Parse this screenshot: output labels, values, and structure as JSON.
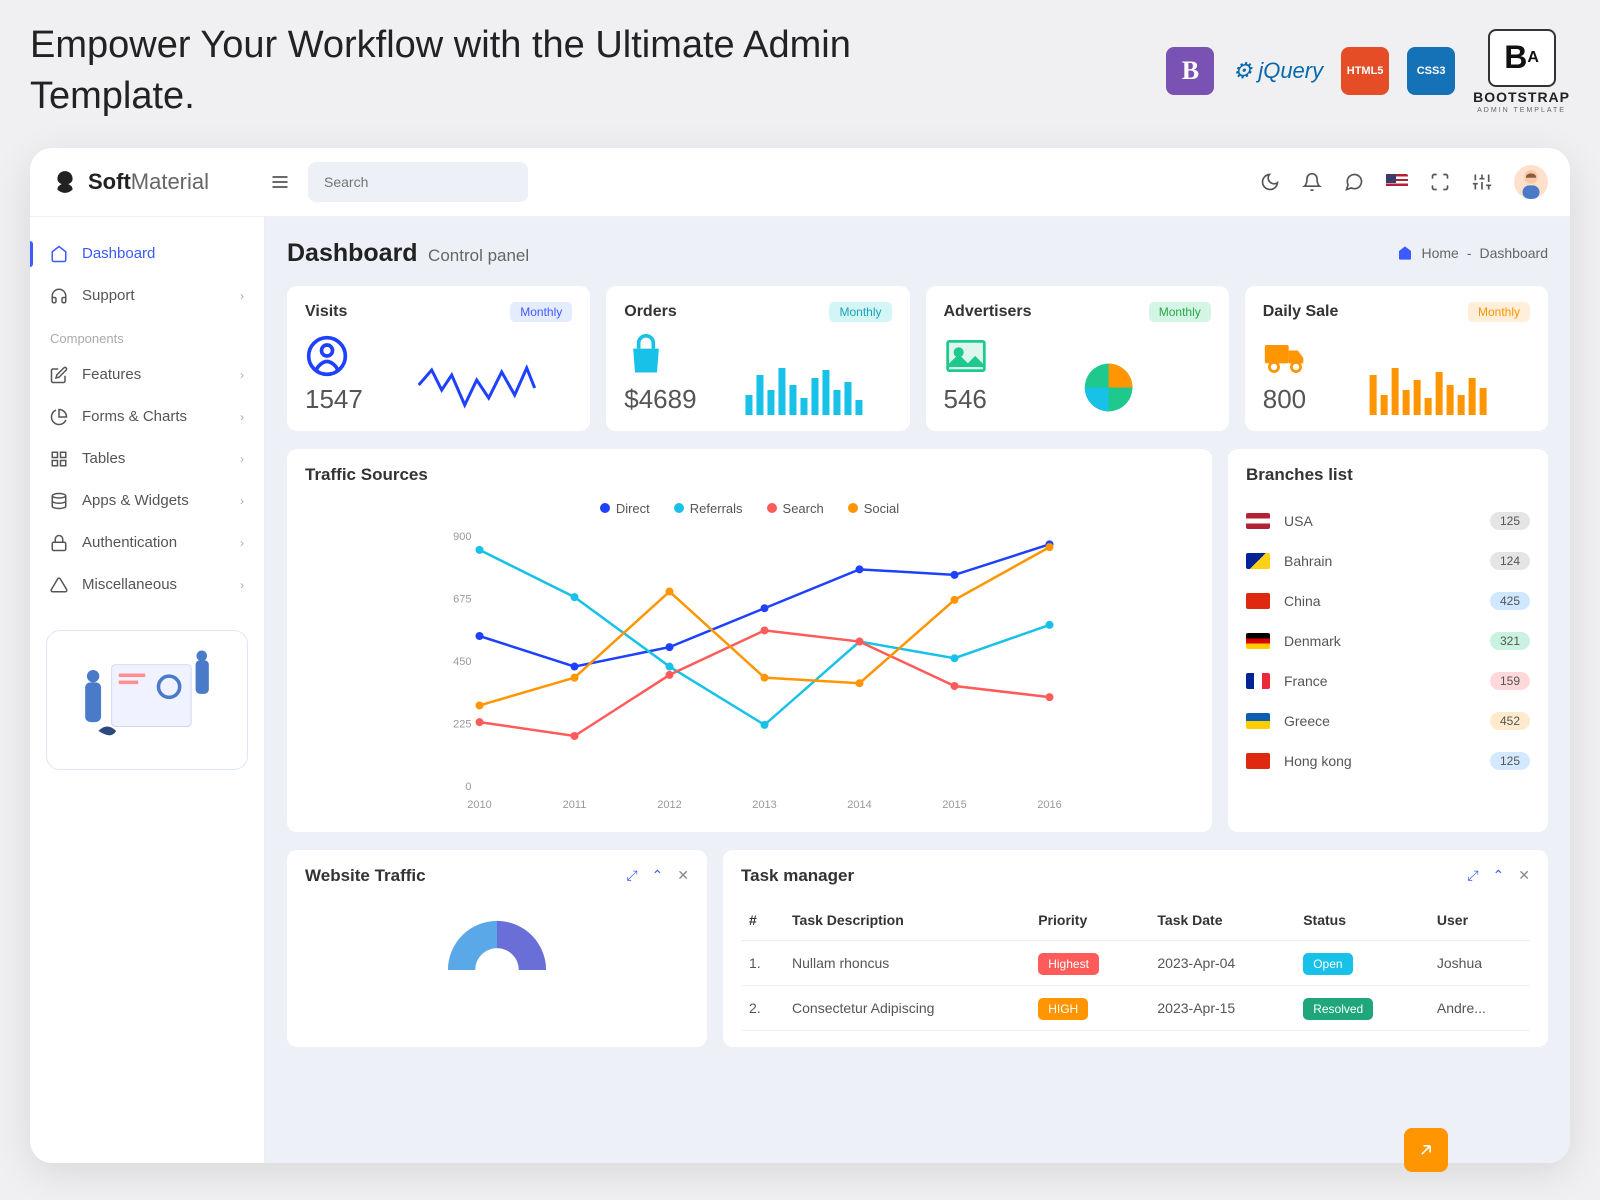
{
  "tagline": "Empower Your Workflow with the Ultimate Admin Template.",
  "brand_logo_text": "B",
  "brand_logo_sub": "A",
  "brand_text_1": "BOOTSTRAP",
  "brand_text_2": "ADMIN TEMPLATE",
  "jquery_text": "jQuery",
  "html5_text": "HTML5",
  "css3_text": "CSS3",
  "app": {
    "name_bold": "Soft",
    "name_light": "Material"
  },
  "search": {
    "placeholder": "Search"
  },
  "sidebar": {
    "dashboard": "Dashboard",
    "support": "Support",
    "components_label": "Components",
    "features": "Features",
    "forms": "Forms & Charts",
    "tables": "Tables",
    "apps": "Apps & Widgets",
    "auth": "Authentication",
    "misc": "Miscellaneous"
  },
  "page": {
    "title": "Dashboard",
    "subtitle": "Control panel",
    "breadcrumb_home": "Home",
    "breadcrumb_current": "Dashboard",
    "sep": "-"
  },
  "stats": {
    "visits": {
      "title": "Visits",
      "value": "1547",
      "badge": "Monthly"
    },
    "orders": {
      "title": "Orders",
      "value": "$4689",
      "badge": "Monthly"
    },
    "advertisers": {
      "title": "Advertisers",
      "value": "546",
      "badge": "Monthly"
    },
    "daily_sale": {
      "title": "Daily Sale",
      "value": "800",
      "badge": "Monthly"
    }
  },
  "traffic": {
    "title": "Traffic Sources",
    "legend": {
      "direct": "Direct",
      "referrals": "Referrals",
      "search": "Search",
      "social": "Social"
    }
  },
  "chart_data": {
    "type": "line",
    "categories": [
      "2010",
      "2011",
      "2012",
      "2013",
      "2014",
      "2015",
      "2016"
    ],
    "ylim": [
      0,
      900
    ],
    "yticks": [
      0,
      225,
      450,
      675,
      900
    ],
    "series": [
      {
        "name": "Direct",
        "color": "#1e40ff",
        "values": [
          540,
          430,
          500,
          640,
          780,
          760,
          870
        ]
      },
      {
        "name": "Referrals",
        "color": "#17c1e8",
        "values": [
          850,
          680,
          430,
          220,
          520,
          460,
          580
        ]
      },
      {
        "name": "Search",
        "color": "#ff5b5b",
        "values": [
          230,
          180,
          400,
          560,
          520,
          360,
          320
        ]
      },
      {
        "name": "Social",
        "color": "#ff9500",
        "values": [
          290,
          390,
          700,
          390,
          370,
          670,
          860
        ]
      }
    ]
  },
  "branches": {
    "title": "Branches list",
    "items": [
      {
        "name": "USA",
        "count": "125",
        "badge": "#e5e5e5",
        "flag": "linear-gradient(#b22234 33%,white 33%,white 66%,#b22234 66%)"
      },
      {
        "name": "Bahrain",
        "count": "124",
        "badge": "#e5e5e5",
        "flag": "linear-gradient(135deg,#002395 50%,#fcd116 50%)"
      },
      {
        "name": "China",
        "count": "425",
        "badge": "#cfe8ff",
        "flag": "#de2910"
      },
      {
        "name": "Denmark",
        "count": "321",
        "badge": "#c9f2e0",
        "flag": "linear-gradient(#000 33%,#dd0000 33%,#dd0000 66%,#ffce00 66%)"
      },
      {
        "name": "France",
        "count": "159",
        "badge": "#ffd9d9",
        "flag": "linear-gradient(90deg,#002395 33%,white 33%,white 66%,#ed2939 66%)"
      },
      {
        "name": "Greece",
        "count": "452",
        "badge": "#ffeacc",
        "flag": "linear-gradient(#0d5eaf 50%,#ffce00 50%)"
      },
      {
        "name": "Hong kong",
        "count": "125",
        "badge": "#d4e9ff",
        "flag": "#de2910"
      }
    ]
  },
  "website_traffic": {
    "title": "Website Traffic"
  },
  "tasks": {
    "title": "Task manager",
    "cols": {
      "idx": "#",
      "desc": "Task Description",
      "priority": "Priority",
      "date": "Task Date",
      "status": "Status",
      "user": "User"
    },
    "rows": [
      {
        "idx": "1.",
        "desc": "Nullam rhoncus",
        "priority": "Highest",
        "priority_class": "pill-red",
        "date": "2023-Apr-04",
        "status": "Open",
        "status_class": "pill-cyan",
        "user": "Joshua"
      },
      {
        "idx": "2.",
        "desc": "Consectetur Adipiscing",
        "priority": "HIGH",
        "priority_class": "pill-orange",
        "date": "2023-Apr-15",
        "status": "Resolved",
        "status_class": "pill-teal",
        "user": "Andre..."
      }
    ]
  }
}
